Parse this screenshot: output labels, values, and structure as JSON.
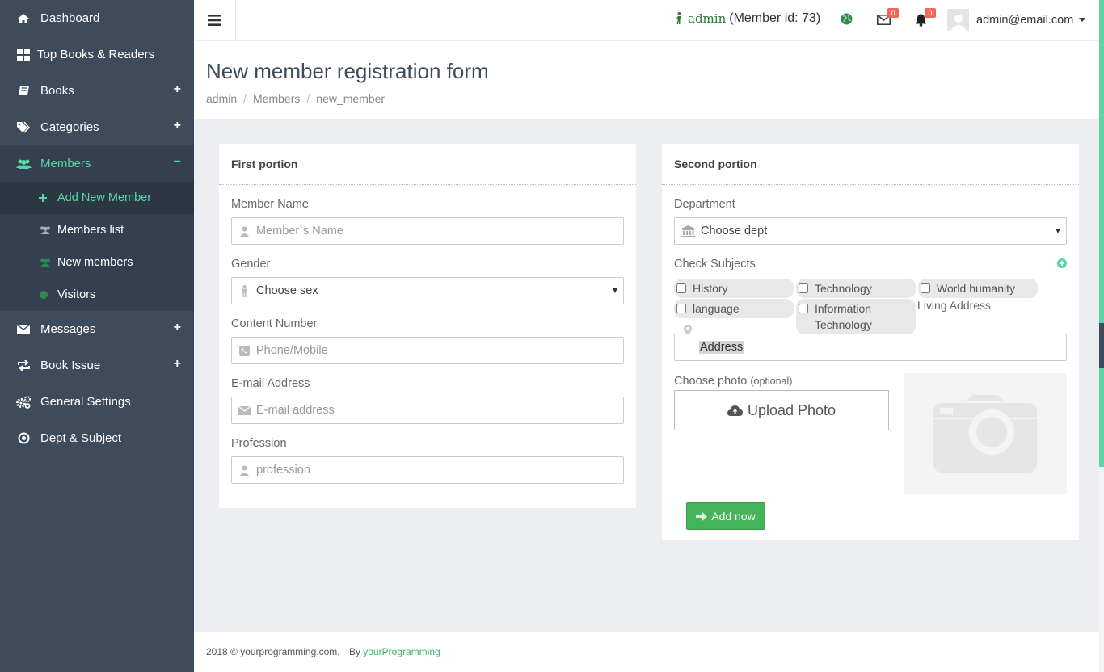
{
  "sidebar": {
    "items": [
      {
        "label": "Dashboard"
      },
      {
        "label": "Top Books & Readers"
      },
      {
        "label": "Books",
        "expand": "+"
      },
      {
        "label": "Categories",
        "expand": "+"
      },
      {
        "label": "Members",
        "expand": "−"
      },
      {
        "label": "Messages",
        "expand": "+"
      },
      {
        "label": "Book Issue",
        "expand": "+"
      },
      {
        "label": "General Settings"
      },
      {
        "label": "Dept & Subject"
      }
    ],
    "members_sub": [
      {
        "label": "Add New Member"
      },
      {
        "label": "Members list"
      },
      {
        "label": "New members"
      },
      {
        "label": "Visitors"
      }
    ]
  },
  "topbar": {
    "admin_name": "admin",
    "member_id_text": "(Member id: 73)",
    "mail_count": "0",
    "notif_count": "0",
    "user_email": "admin@email.com"
  },
  "page": {
    "title": "New member registration form",
    "breadcrumb": [
      "admin",
      "Members",
      "new_member"
    ]
  },
  "first_portion": {
    "title": "First portion",
    "name_label": "Member Name",
    "name_placeholder": "Member`s Name",
    "gender_label": "Gender",
    "gender_value": "Choose sex",
    "contact_label": "Content Number",
    "contact_placeholder": "Phone/Mobile",
    "email_label": "E-mail Address",
    "email_placeholder": "E-mail address",
    "profession_label": "Profession",
    "profession_placeholder": "profession"
  },
  "second_portion": {
    "title": "Second portion",
    "dept_label": "Department",
    "dept_value": "Choose dept",
    "subjects_label": "Check Subjects",
    "subjects": [
      "History",
      "Technology",
      "World humanity",
      "language",
      "Information Technology"
    ],
    "address_label": "Living Address",
    "address_value": "Address",
    "photo_label": "Choose photo",
    "photo_optional": "(optional)",
    "upload_label": "Upload Photo",
    "submit_label": "Add now"
  },
  "footer": {
    "copyright": "2018 © yourprogramming.com.",
    "by": "By",
    "link": "yourProgramming"
  },
  "colors": {
    "sidebar_bg": "#3e4b5b",
    "accent": "#5cd4a4",
    "button_green": "#45b35a",
    "badge_red": "#f0685c"
  }
}
